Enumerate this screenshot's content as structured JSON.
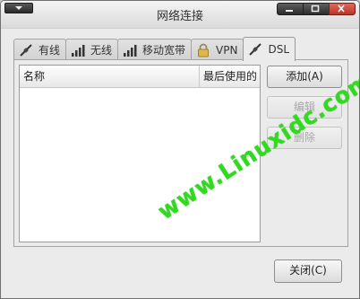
{
  "window": {
    "title": "网络连接"
  },
  "tabs": [
    {
      "label": "有线",
      "icon": "wired-icon",
      "active": false
    },
    {
      "label": "无线",
      "icon": "signal-bars-icon",
      "active": false
    },
    {
      "label": "移动宽带",
      "icon": "signal-bars-icon",
      "active": false
    },
    {
      "label": "VPN",
      "icon": "lock-icon",
      "active": false
    },
    {
      "label": "DSL",
      "icon": "wired-icon",
      "active": true
    }
  ],
  "list": {
    "columns": [
      "名称",
      "最后使用的"
    ],
    "rows": []
  },
  "buttons": {
    "add": "添加(A)",
    "edit": "编辑",
    "delete": "删除",
    "close": "关闭(C)"
  },
  "watermark": "www.Linuxidc.com",
  "colors": {
    "watermark": "#2fdc1d",
    "close_button": "#c8402f"
  }
}
